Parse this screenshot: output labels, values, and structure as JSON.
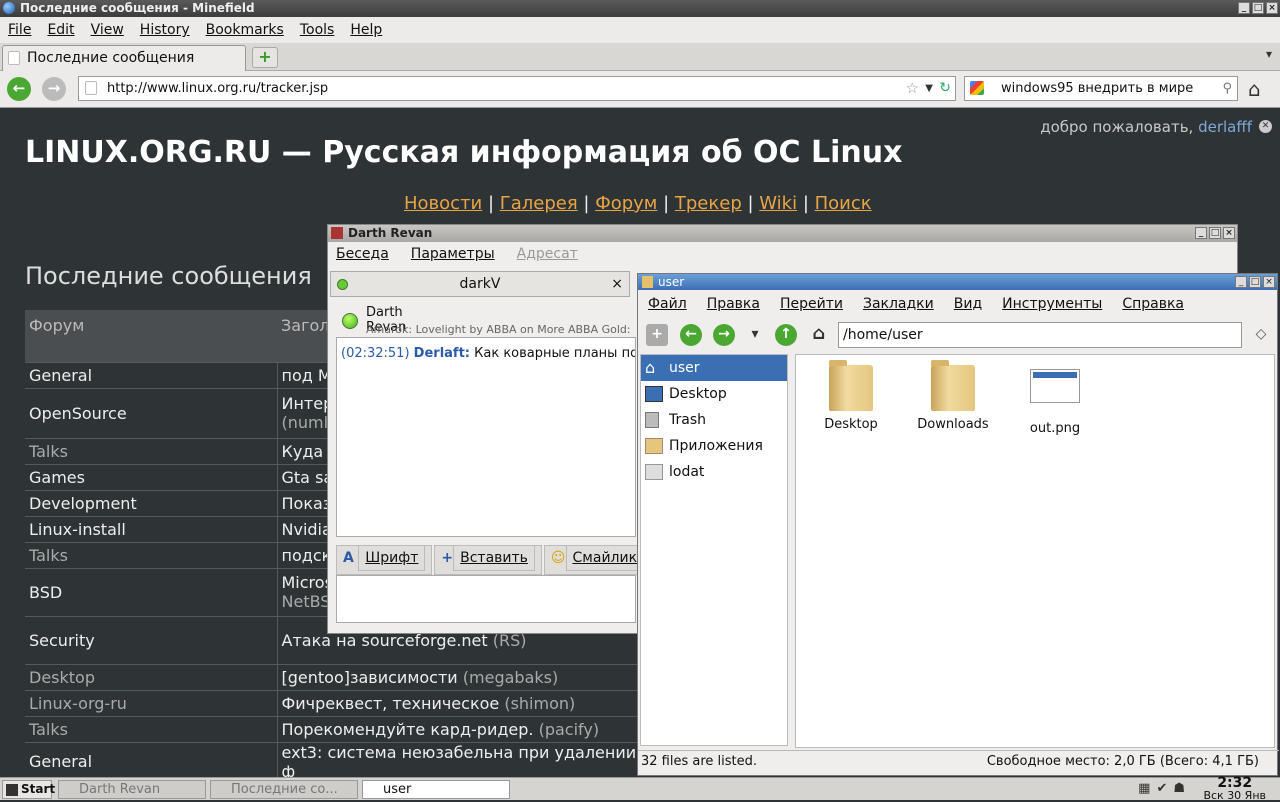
{
  "browser": {
    "window_title": "Последние сообщения - Minefield",
    "menu": [
      "File",
      "Edit",
      "View",
      "History",
      "Bookmarks",
      "Tools",
      "Help"
    ],
    "tab_title": "Последние сообщения",
    "url": "http://www.linux.org.ru/tracker.jsp",
    "search_value": "windows95 внедрить в мире"
  },
  "page": {
    "welcome_text": "добро пожаловать,",
    "welcome_user": "derlafff",
    "site_title": "LINUX.ORG.RU — Русская информация об ОС Linux",
    "nav": [
      "Новости",
      "Галерея",
      "Форум",
      "Трекер",
      "Wiki",
      "Поиск"
    ],
    "section_title": "Последние сообщения",
    "table_headers": [
      "Форум",
      "Загол"
    ],
    "rows": [
      {
        "forum": "General",
        "title": "под М",
        "author": "",
        "gray": false
      },
      {
        "forum": "OpenSource",
        "title": "Интер",
        "author": "(numl",
        "gray": false
      },
      {
        "forum": "Talks",
        "title": "Куда",
        "author": "",
        "gray": true
      },
      {
        "forum": "Games",
        "title": "Gta sa",
        "author": "",
        "gray": false
      },
      {
        "forum": "Development",
        "title": "Показ",
        "author": "",
        "gray": false
      },
      {
        "forum": "Linux-install",
        "title": "Nvidia",
        "author": "",
        "gray": false
      },
      {
        "forum": "Talks",
        "title": "подск",
        "author": "",
        "gray": true
      },
      {
        "forum": "BSD",
        "title": "Micros",
        "author": "NetBS",
        "gray": false
      },
      {
        "forum": "Security",
        "title": "Атака на sourceforge.net",
        "author": "(RS)",
        "gray": false
      },
      {
        "forum": "Desktop",
        "title": "[gentoo]зависимости",
        "author": "(megabaks)",
        "gray": true
      },
      {
        "forum": "Linux-org-ru",
        "title": "Фичреквест, техническое",
        "author": "(shimon)",
        "gray": true
      },
      {
        "forum": "Talks",
        "title": "Порекомендуйте кард-ридер.",
        "author": "(pacify)",
        "gray": true
      },
      {
        "forum": "General",
        "title": "ext3: система неюзабельна при удалении ф",
        "author": "",
        "gray": false
      }
    ]
  },
  "chat": {
    "window_title": "Darth Revan",
    "menu": [
      "Беседа",
      "Параметры",
      "Адресат"
    ],
    "tab_label": "darkV",
    "contact_name": "Darth Revan",
    "contact_status": "Amarok: Lovelight by ABBA on More ABBA Gold:",
    "message_time": "(02:32:51)",
    "message_nick": "Derlaft:",
    "message_text": "Как коварные планы по",
    "tools": [
      "Шрифт",
      "Вставить",
      "Смайлик!"
    ]
  },
  "filemanager": {
    "window_title": "user",
    "menu": [
      "Файл",
      "Правка",
      "Перейти",
      "Закладки",
      "Вид",
      "Инструменты",
      "Справка"
    ],
    "path": "/home/user",
    "sidebar": [
      "user",
      "Desktop",
      "Trash",
      "Приложения",
      "lodat"
    ],
    "files": [
      {
        "name": "Desktop",
        "type": "folder"
      },
      {
        "name": "Downloads",
        "type": "folder"
      },
      {
        "name": "out.png",
        "type": "image"
      }
    ],
    "status_left": "32 files are listed.",
    "status_right": "Свободное место: 2,0 ГБ (Всего: 4,1 ГБ)"
  },
  "taskbar": {
    "start": "Start",
    "tasks": [
      "Darth Revan",
      "Последние со...",
      "user"
    ],
    "time": "2:32",
    "date": "Вск 30 Янв"
  }
}
